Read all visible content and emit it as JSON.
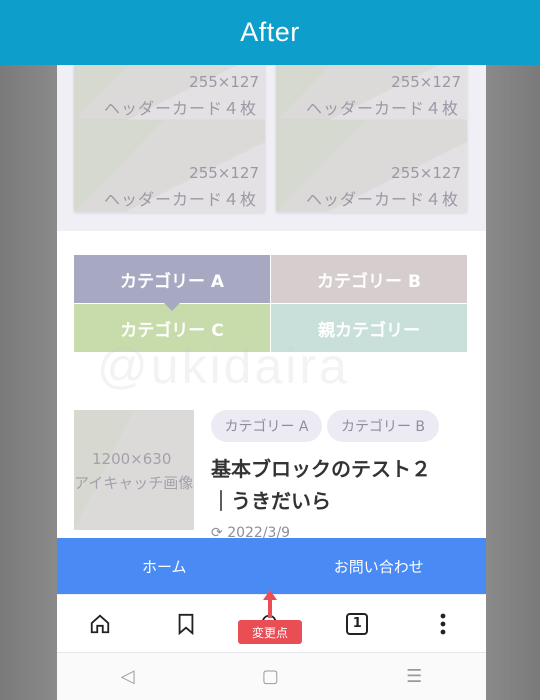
{
  "banner": {
    "title": "After"
  },
  "header_cards": [
    {
      "size": "255×127",
      "label": "ヘッダーカード４枚"
    },
    {
      "size": "255×127",
      "label": "ヘッダーカード４枚"
    },
    {
      "size": "255×127",
      "label": "ヘッダーカード４枚"
    },
    {
      "size": "255×127",
      "label": "ヘッダーカード４枚"
    }
  ],
  "categories": {
    "a": "カテゴリー A",
    "b": "カテゴリー B",
    "c": "カテゴリー C",
    "parent": "親カテゴリー"
  },
  "watermark": "@ukidaira",
  "post": {
    "thumb_size": "1200×630",
    "thumb_label": "アイキャッチ画像",
    "tags": [
      "カテゴリー A",
      "カテゴリー B"
    ],
    "title": "基本ブロックのテスト２｜うきだいら",
    "date": "2022/3/9"
  },
  "bottom_menu": {
    "home": "ホーム",
    "contact": "お問い合わせ"
  },
  "browser_bar": {
    "tab_count": "1"
  },
  "annotation": {
    "badge": "変更点"
  },
  "colors": {
    "banner": "#0d9ecb",
    "bottom_menu": "#4a8af4",
    "category_a": "#a7a9c3",
    "category_b": "#d6cdce",
    "category_c": "#c8dcab",
    "parent_category": "#c9dfda",
    "change_marker": "#e94e55"
  }
}
